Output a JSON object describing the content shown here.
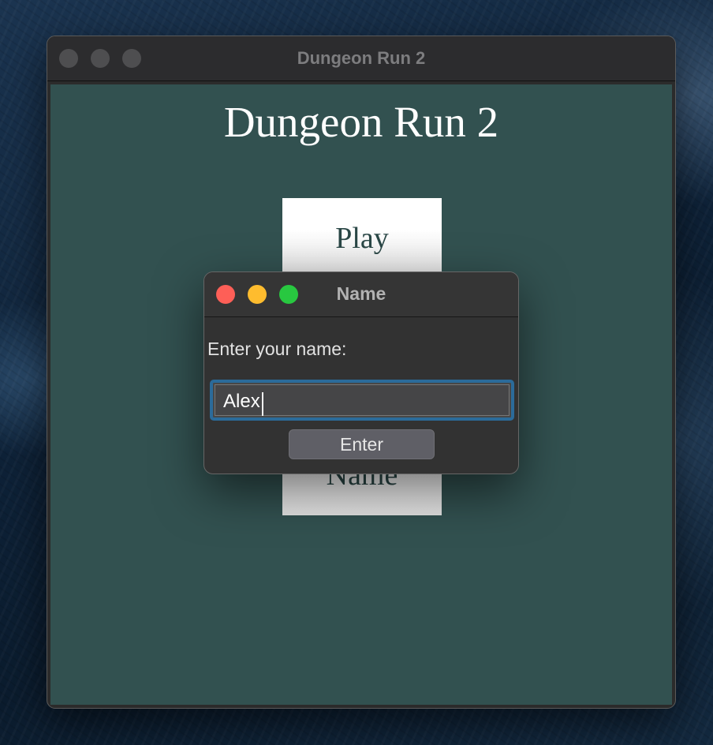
{
  "main_window": {
    "title": "Dungeon Run 2",
    "game_title": "Dungeon Run 2",
    "buttons": {
      "play": "Play",
      "name": "Name"
    }
  },
  "dialog": {
    "title": "Name",
    "prompt": "Enter your name:",
    "input_value": "Alex",
    "enter_label": "Enter"
  },
  "colors": {
    "window_content": "#325150",
    "game_text": "#ffffff",
    "button_text": "#2a4746",
    "focus_ring": "#2b6b9a",
    "close": "#fe5f57",
    "minimize": "#febc2e",
    "zoom": "#28c840"
  }
}
